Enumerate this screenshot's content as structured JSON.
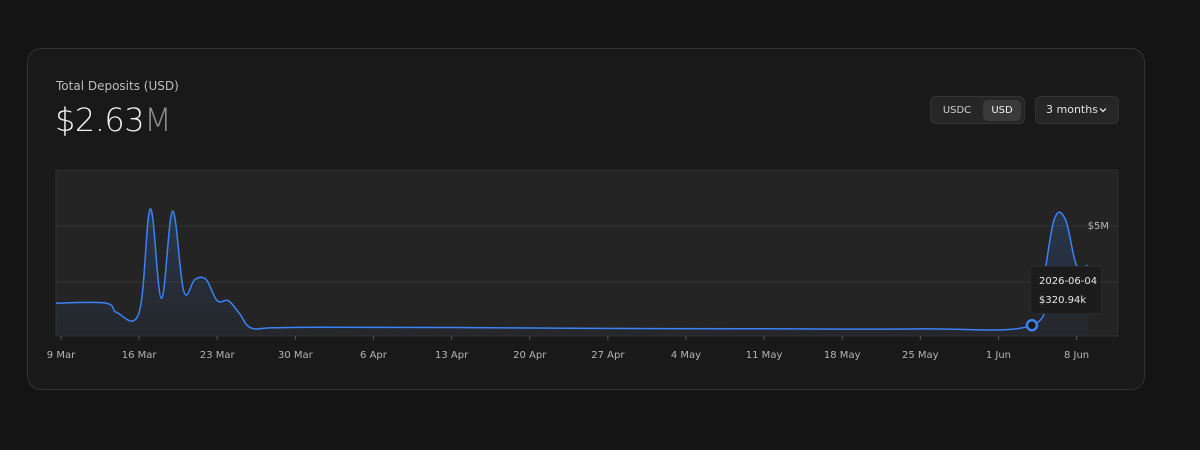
{
  "card": {
    "title": "Total Deposits (USD)",
    "value_main": "$2.63",
    "value_unit": "M"
  },
  "controls": {
    "currency_options": [
      "USDC",
      "USD"
    ],
    "currency_selected": "USD",
    "range_label": "3 months"
  },
  "tooltip": {
    "date": "2026-06-04",
    "value": "$320.94k"
  },
  "colors": {
    "accent": "#3b82f6",
    "background": "#141414",
    "card": "#191919",
    "plot": "#242424"
  },
  "chart_data": {
    "type": "area",
    "title": "",
    "xlabel": "",
    "ylabel": "",
    "x_ticks": [
      "9 Mar",
      "16 Mar",
      "23 Mar",
      "30 Mar",
      "6 Apr",
      "13 Apr",
      "20 Apr",
      "27 Apr",
      "4 May",
      "11 May",
      "18 May",
      "25 May",
      "1 Jun",
      "8 Jun"
    ],
    "y_tick_labels": [
      "$5M"
    ],
    "grid": "horizontal",
    "series": [
      {
        "x": [
          "2026-03-08",
          "2026-03-13",
          "2026-03-14",
          "2026-03-16",
          "2026-03-17",
          "2026-03-18",
          "2026-03-19",
          "2026-03-20",
          "2026-03-21",
          "2026-03-22",
          "2026-03-23",
          "2026-03-24",
          "2026-03-25",
          "2026-03-26",
          "2026-03-28",
          "2026-04-01",
          "2026-04-13",
          "2026-04-26",
          "2026-05-10",
          "2026-05-25",
          "2026-06-04",
          "2026-06-05",
          "2026-06-06",
          "2026-06-07",
          "2026-06-08",
          "2026-06-09"
        ],
        "y": [
          2.2,
          2.2,
          1.4,
          1.4,
          10.2,
          2.6,
          10.0,
          3.2,
          4.2,
          4.2,
          2.4,
          2.4,
          1.3,
          0.1,
          0.1,
          0.15,
          0.13,
          0.05,
          0.02,
          0.01,
          0.32,
          4.0,
          9.3,
          9.3,
          5.4,
          5.4
        ]
      }
    ],
    "ylim": [
      0,
      13.5
    ]
  }
}
